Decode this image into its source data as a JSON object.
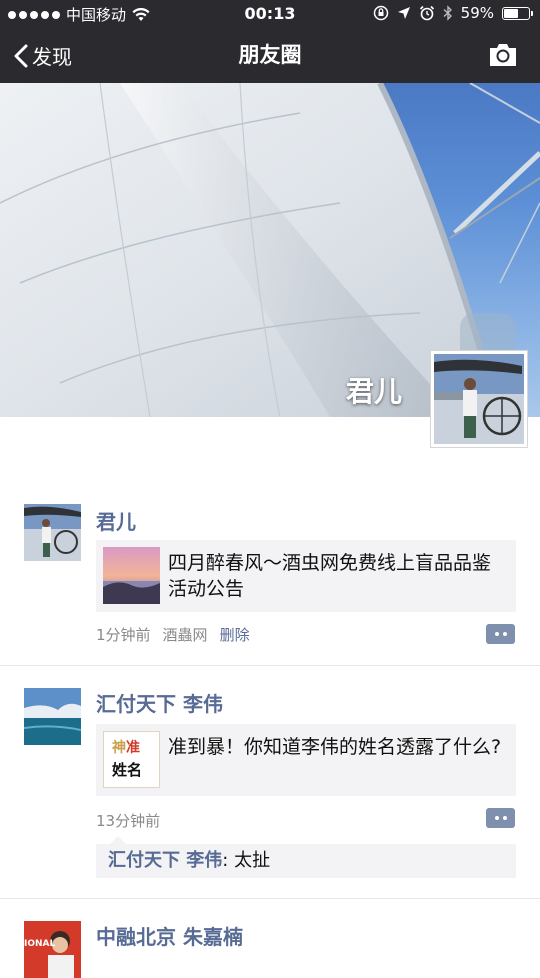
{
  "status_bar": {
    "carrier": "中国移动",
    "time": "00:13",
    "battery": "59%",
    "battery_level": 0.59
  },
  "nav": {
    "back_label": "发现",
    "title": "朋友圈",
    "camera_icon": "camera-icon"
  },
  "cover": {
    "user_name": "君儿"
  },
  "posts": [
    {
      "author": "君儿",
      "link_text": "四月醉春风～酒虫网免费线上盲品品鉴活动公告",
      "time": "1分钟前",
      "source": "酒蟲网",
      "delete_label": "删除"
    },
    {
      "author": "汇付天下 李伟",
      "link_text": "准到暴！你知道李伟的姓名透露了什么?",
      "thumb_text_top_1": "神",
      "thumb_text_top_2": "准",
      "thumb_text_bottom": "姓名",
      "time": "13分钟前",
      "comment_author": "汇付天下 李伟",
      "comment_sep": ": ",
      "comment_text": "太扯"
    },
    {
      "author": "中融北京 朱嘉楠",
      "thumb_text": "IONAL"
    }
  ],
  "colors": {
    "bar_bg": "#2b2b2f",
    "link_blue": "#576b95",
    "card_bg": "#f3f3f5"
  }
}
